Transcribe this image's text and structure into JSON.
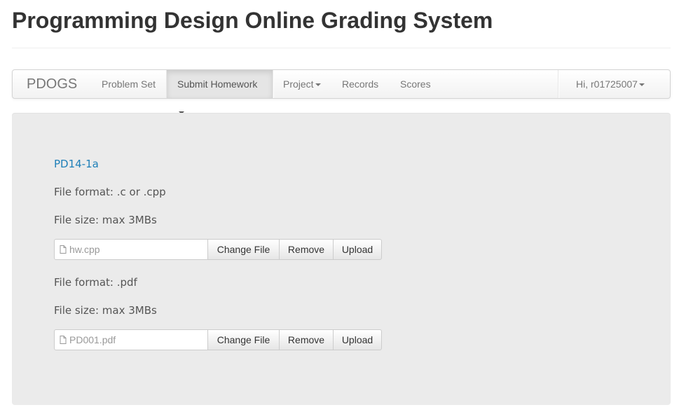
{
  "header": {
    "title": "Programming Design Online Grading System"
  },
  "navbar": {
    "brand": "PDOGS",
    "items": [
      {
        "label": "Problem Set",
        "dropdown": false,
        "active": false
      },
      {
        "label": "Submit Homework",
        "dropdown": true,
        "active": true
      },
      {
        "label": "Project",
        "dropdown": true,
        "active": false
      },
      {
        "label": "Records",
        "dropdown": false,
        "active": false
      },
      {
        "label": "Scores",
        "dropdown": false,
        "active": false
      }
    ],
    "user_greeting": "Hi, r01725007"
  },
  "main": {
    "problem_id": "PD14-1a",
    "uploads": [
      {
        "format_text": "File format: .c or .cpp",
        "size_text": "File size: max 3MBs",
        "filename": "hw.cpp",
        "change_label": "Change File",
        "remove_label": "Remove",
        "upload_label": "Upload"
      },
      {
        "format_text": "File format: .pdf",
        "size_text": "File size: max 3MBs",
        "filename": "PD001.pdf",
        "change_label": "Change File",
        "remove_label": "Remove",
        "upload_label": "Upload"
      }
    ]
  },
  "icons": {
    "file_icon": "file-icon",
    "caret_icon": "caret-down-icon"
  },
  "colors": {
    "link": "#1e7fb8",
    "well_background": "#ebebeb",
    "active_nav_background": "#e5e5e5"
  }
}
